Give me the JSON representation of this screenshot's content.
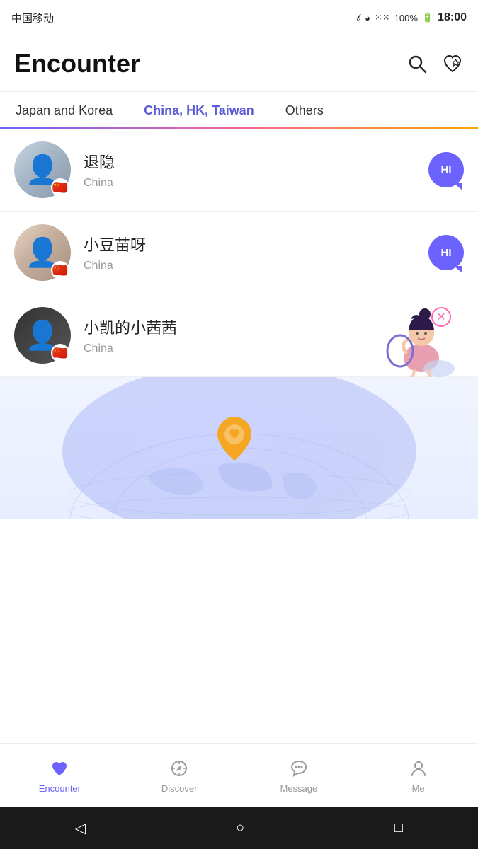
{
  "statusBar": {
    "carrier": "中国移动",
    "time": "18:00",
    "battery": "100%",
    "signal": "4G"
  },
  "header": {
    "title": "Encounter",
    "searchLabel": "search",
    "likeLabel": "like"
  },
  "tabs": [
    {
      "id": "japan",
      "label": "Japan and Korea",
      "active": false
    },
    {
      "id": "china",
      "label": "China, HK, Taiwan",
      "active": true
    },
    {
      "id": "others",
      "label": "Others",
      "active": false
    }
  ],
  "users": [
    {
      "id": 1,
      "name": "退隐",
      "location": "China",
      "hiLabel": "HI",
      "flag": "🇨🇳"
    },
    {
      "id": 2,
      "name": "小豆苗呀",
      "location": "China",
      "hiLabel": "HI",
      "flag": "🇨🇳"
    },
    {
      "id": 3,
      "name": "小凯的小茜茜",
      "location": "China",
      "hiLabel": "",
      "flag": "🇨🇳"
    }
  ],
  "bottomNav": [
    {
      "id": "encounter",
      "label": "Encounter",
      "active": true,
      "icon": "heart"
    },
    {
      "id": "discover",
      "label": "Discover",
      "active": false,
      "icon": "compass"
    },
    {
      "id": "message",
      "label": "Message",
      "active": false,
      "icon": "bell"
    },
    {
      "id": "me",
      "label": "Me",
      "active": false,
      "icon": "person"
    }
  ],
  "systemBar": {
    "backIcon": "◁",
    "homeIcon": "○",
    "recentIcon": "□"
  }
}
